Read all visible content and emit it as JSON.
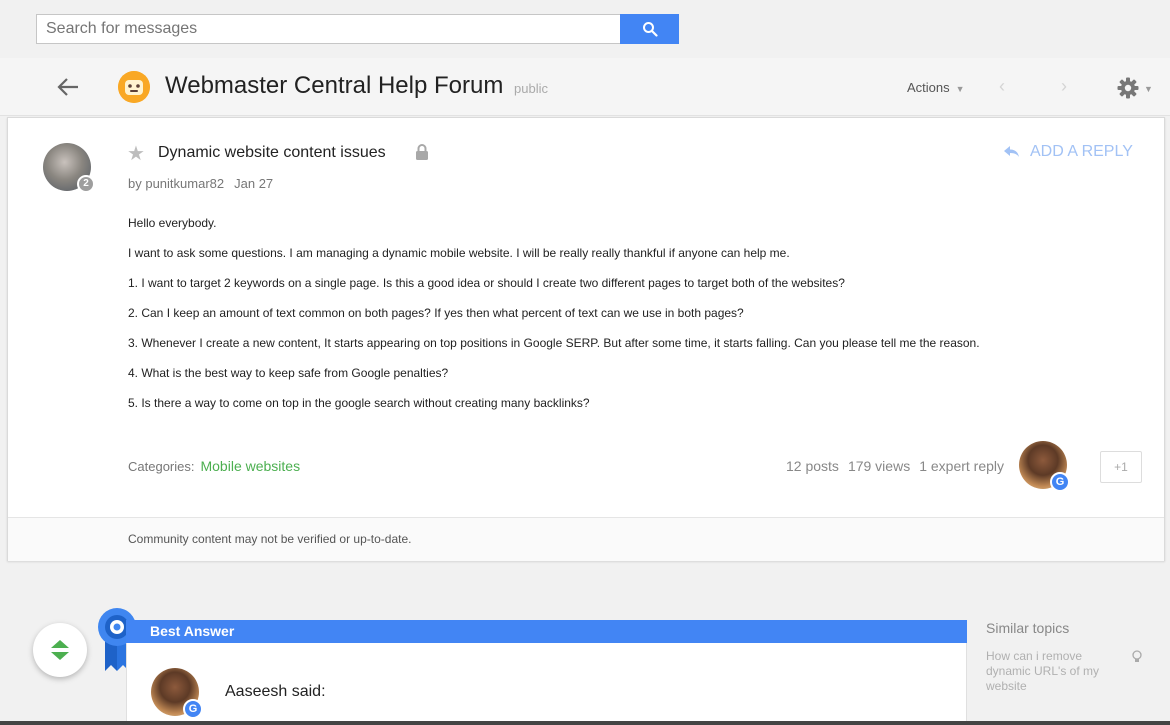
{
  "search": {
    "placeholder": "Search for messages"
  },
  "forum": {
    "title": "Webmaster Central Help Forum",
    "visibility": "public",
    "actions_label": "Actions",
    "nav_prev": "‹",
    "nav_next": "›"
  },
  "post": {
    "title": "Dynamic website content issues",
    "author": "punitkumar82",
    "date": "Jan 27",
    "author_badge": "2",
    "reply_label": "ADD A REPLY",
    "body": [
      "Hello everybody.",
      "I want to ask some questions. I am managing a dynamic mobile website. I will be really really thankful if anyone can help me.",
      "1. I want to target 2 keywords on a single page. Is this a good idea or should I create two different pages to target both of the websites?",
      "2. Can I keep an amount of text common on both pages? If yes then what percent of text can we use in both pages?",
      "3. Whenever I create a new content, It starts appearing on top positions in Google SERP. But after some time, it starts falling. Can you please tell me the reason.",
      "4. What is the best way to keep safe from Google penalties?",
      "5. Is there a way to come on top in the google search without creating many backlinks?"
    ],
    "categories_label": "Categories:",
    "category": "Mobile websites",
    "posts": "12 posts",
    "views": "179 views",
    "expert_reply": "1 expert reply",
    "plus_one": "+1",
    "footer_note": "Community content may not be verified or up-to-date."
  },
  "best_answer": {
    "label": "Best Answer",
    "author_said": "Aaseesh said:"
  },
  "similar": {
    "heading": "Similar topics",
    "items": [
      "How can i remove dynamic URL's of my website"
    ]
  },
  "colors": {
    "accent": "#4285f4",
    "category": "#4caf50",
    "reply": "#a2c2f5"
  }
}
